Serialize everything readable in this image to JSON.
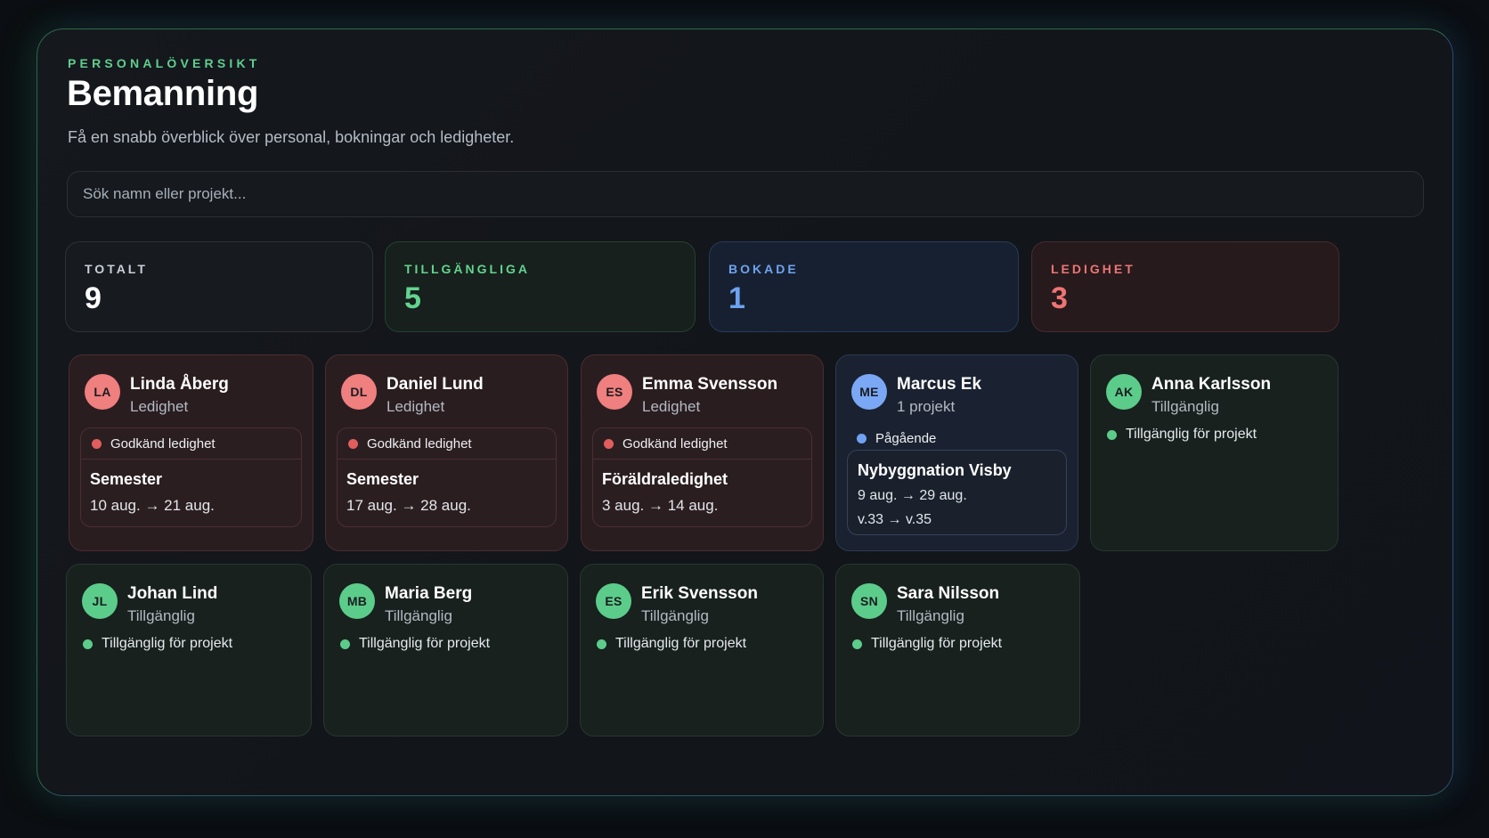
{
  "header": {
    "eyebrow": "PERSONALÖVERSIKT",
    "title": "Bemanning",
    "subtitle": "Få en snabb överblick över personal, bokningar och ledigheter."
  },
  "search": {
    "placeholder": "Sök namn eller projekt...",
    "value": ""
  },
  "stats": [
    {
      "label": "TOTALT",
      "value": "9"
    },
    {
      "label": "TILLGÄNGLIGA",
      "value": "5"
    },
    {
      "label": "BOKADE",
      "value": "1"
    },
    {
      "label": "LEDIGHET",
      "value": "3"
    }
  ],
  "people": [
    {
      "initials": "LA",
      "name": "Linda Åberg",
      "status": "Ledighet",
      "leave_label": "Godkänd ledighet",
      "leave_type": "Semester",
      "dates": "10 aug. → 21 aug."
    },
    {
      "initials": "DL",
      "name": "Daniel Lund",
      "status": "Ledighet",
      "leave_label": "Godkänd ledighet",
      "leave_type": "Semester",
      "dates": "17 aug. → 28 aug."
    },
    {
      "initials": "ES",
      "name": "Emma Svensson",
      "status": "Ledighet",
      "leave_label": "Godkänd ledighet",
      "leave_type": "Föräldraledighet",
      "dates": "3 aug. → 14 aug."
    },
    {
      "initials": "ME",
      "name": "Marcus Ek",
      "status": "1 projekt",
      "project_state": "Pågående",
      "project_name": "Nybyggnation Visby",
      "dates": "9 aug. → 29 aug.",
      "weeks": "v.33 → v.35"
    },
    {
      "initials": "AK",
      "name": "Anna Karlsson",
      "status": "Tillgänglig",
      "availability": "Tillgänglig för projekt"
    },
    {
      "initials": "JL",
      "name": "Johan Lind",
      "status": "Tillgänglig",
      "availability": "Tillgänglig för projekt"
    },
    {
      "initials": "MB",
      "name": "Maria Berg",
      "status": "Tillgänglig",
      "availability": "Tillgänglig för projekt"
    },
    {
      "initials": "ES",
      "name": "Erik Svensson",
      "status": "Tillgänglig",
      "availability": "Tillgänglig för projekt"
    },
    {
      "initials": "SN",
      "name": "Sara Nilsson",
      "status": "Tillgänglig",
      "availability": "Tillgänglig för projekt"
    }
  ],
  "colors": {
    "accent_green": "#5ccc8a",
    "accent_blue": "#6fa2f2",
    "accent_red": "#ee7474",
    "background": "#0b0e12"
  }
}
